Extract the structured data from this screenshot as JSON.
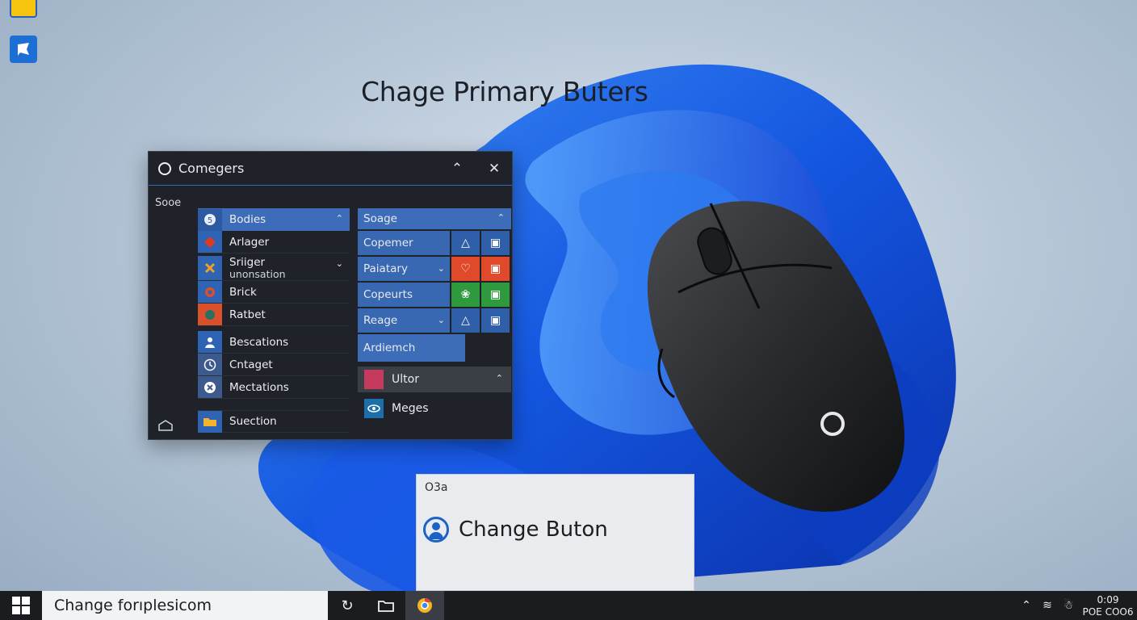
{
  "page_title": "Chage Primary Buters",
  "window": {
    "title": "Comegers",
    "section_label": "Sooe",
    "left_list": [
      {
        "label": "Bodies",
        "icon": "dollar-icon",
        "header": true
      },
      {
        "label": "Arlager",
        "icon": "red-gem-icon"
      },
      {
        "label": "Sriiger",
        "sublabel": "unonsation",
        "icon": "x-cross-icon",
        "expandable": true
      },
      {
        "label": "Brick",
        "icon": "gear-icon"
      },
      {
        "label": "Ratbet",
        "icon": "orange-badge-icon"
      },
      {
        "label": "Bescations",
        "icon": "person-icon"
      },
      {
        "label": "Cntaget",
        "icon": "clock-icon"
      },
      {
        "label": "Mectations",
        "icon": "close-circle-icon"
      },
      {
        "label": "Suection",
        "icon": "folder-icon"
      }
    ],
    "right_header": "Soage",
    "right_rows": [
      {
        "label": "Copemer",
        "tiles": [
          "warning-icon",
          "window-icon"
        ],
        "tile_colors": [
          "blue",
          "blue"
        ]
      },
      {
        "label": "Paiatary",
        "tiles": [
          "heart-icon",
          "lock-icon"
        ],
        "tile_colors": [
          "red",
          "red"
        ]
      },
      {
        "label": "Copeurts",
        "tiles": [
          "flower-icon",
          "square-icon"
        ],
        "tile_colors": [
          "green",
          "green"
        ]
      },
      {
        "label": "Reage",
        "tiles": [
          "warning-icon",
          "image-icon"
        ],
        "tile_colors": [
          "blue",
          "blue"
        ]
      }
    ],
    "wide_item": "Ardiemch",
    "ultor": "Ultor",
    "meges": "Meges"
  },
  "card": {
    "top_text": "O3a",
    "button_label": "Change Buton"
  },
  "taskbar": {
    "search_text": "Change forıplesicom",
    "time": "0:09",
    "date": "POE COO6"
  }
}
